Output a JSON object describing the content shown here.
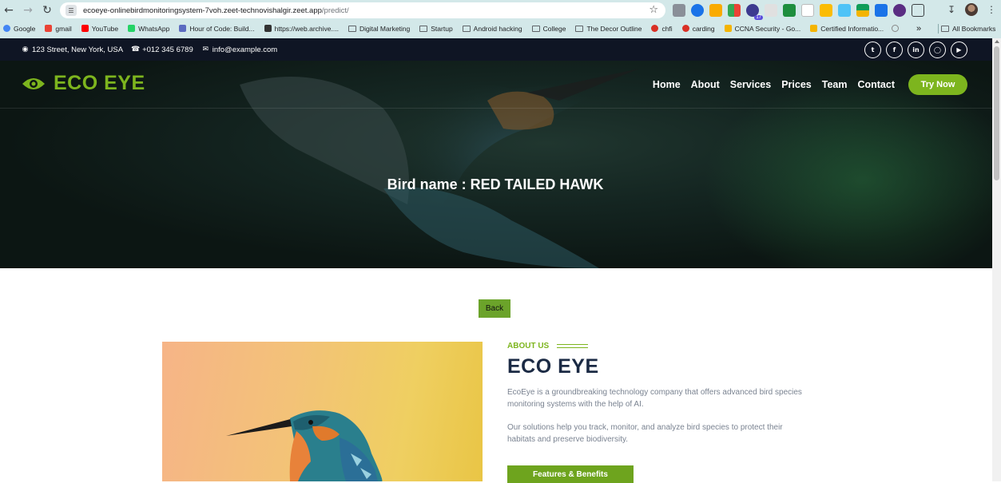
{
  "browser": {
    "url_host": "ecoeye-onlinebirdmonitoringsystem-7voh.zeet-technovishalgir.zeet.app",
    "url_path": "/predict/",
    "extension_badge": "17",
    "bookmarks": [
      {
        "label": "Google",
        "icon": "google-icon",
        "color": "#4285f4"
      },
      {
        "label": "gmail",
        "icon": "gmail-icon",
        "color": "#ea4335"
      },
      {
        "label": "YouTube",
        "icon": "youtube-icon",
        "color": "#ff0000"
      },
      {
        "label": "WhatsApp",
        "icon": "whatsapp-icon",
        "color": "#25d366"
      },
      {
        "label": "Hour of Code: Build...",
        "icon": "code-icon",
        "color": "#5c6bc0"
      },
      {
        "label": "https://web.archive....",
        "icon": "archive-icon",
        "color": "#333333"
      },
      {
        "label": "Digital Marketing",
        "icon": "folder-icon",
        "color": ""
      },
      {
        "label": "Startup",
        "icon": "folder-icon",
        "color": ""
      },
      {
        "label": "Android hacking",
        "icon": "folder-icon",
        "color": ""
      },
      {
        "label": "College",
        "icon": "folder-icon",
        "color": ""
      },
      {
        "label": "The Decor Outline",
        "icon": "folder-icon",
        "color": ""
      },
      {
        "label": "chfi",
        "icon": "red-dot-icon",
        "color": "#d93025"
      },
      {
        "label": "carding",
        "icon": "red-dot-icon",
        "color": "#d93025"
      },
      {
        "label": "CCNA Security - Go...",
        "icon": "drive-icon",
        "color": "#f4b400"
      },
      {
        "label": "Certified Informatio...",
        "icon": "drive-icon",
        "color": "#f4b400"
      }
    ],
    "all_bookmarks": "All Bookmarks"
  },
  "topbar": {
    "address": "123 Street, New York, USA",
    "phone": "+012 345 6789",
    "email": "info@example.com",
    "socials": [
      "twitter-icon",
      "facebook-icon",
      "linkedin-icon",
      "instagram-icon",
      "youtube-icon"
    ]
  },
  "nav": {
    "logo": "ECO EYE",
    "items": [
      "Home",
      "About",
      "Services",
      "Prices",
      "Team",
      "Contact"
    ],
    "cta": "Try Now"
  },
  "hero": {
    "title": "Bird name : RED TAILED HAWK"
  },
  "back_label": "Back",
  "about": {
    "label": "ABOUT US",
    "title": "ECO EYE",
    "p1": "EcoEye is a groundbreaking technology company that offers advanced bird species monitoring systems with the help of AI.",
    "p2": "Our solutions help you track, monitor, and analyze bird species to protect their habitats and preserve biodiversity.",
    "button": "Features & Benefits"
  },
  "colors": {
    "accent": "#7db51e",
    "dark": "#0f1524",
    "heading": "#1b2a44"
  }
}
